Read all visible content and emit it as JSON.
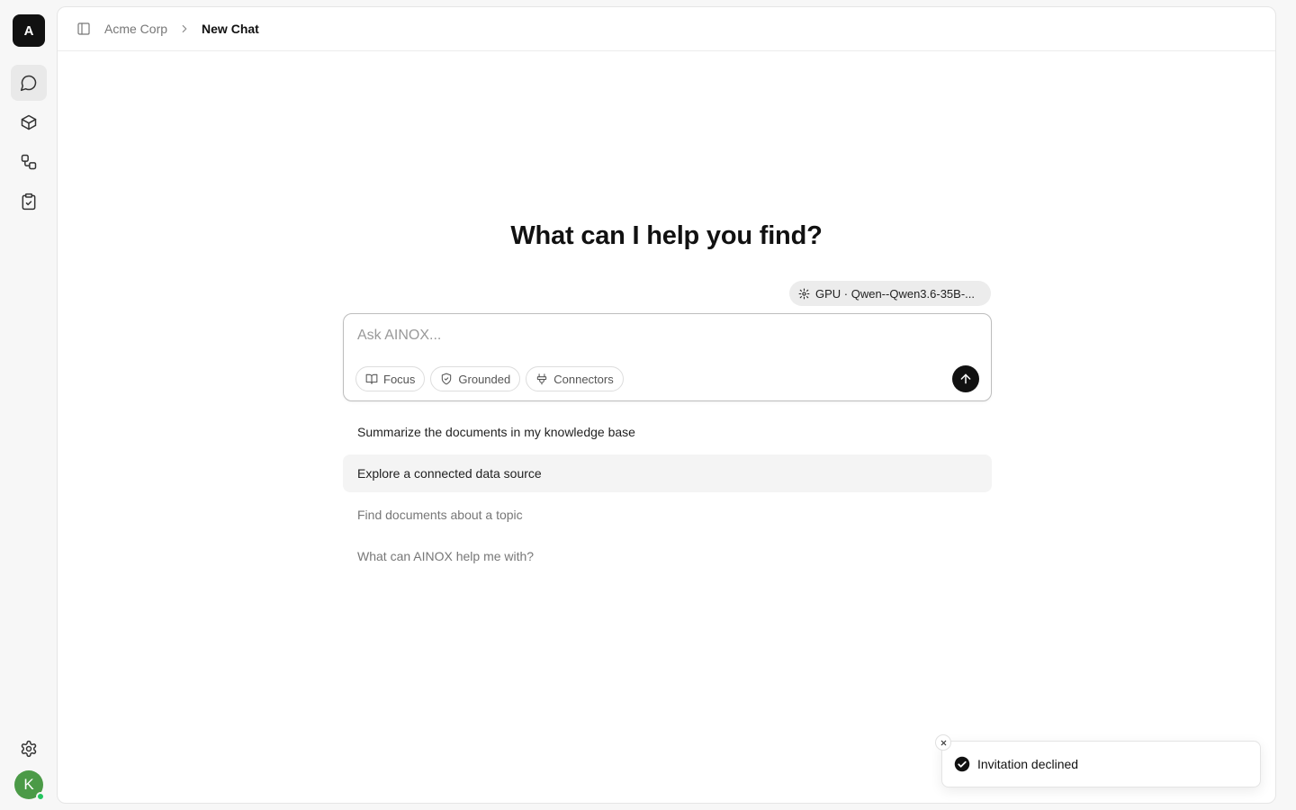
{
  "app": {
    "logo_letter": "A"
  },
  "rail": {
    "items": [
      {
        "name": "chat-icon",
        "active": true
      },
      {
        "name": "box-icon",
        "active": false
      },
      {
        "name": "workflow-icon",
        "active": false
      },
      {
        "name": "clipboard-check-icon",
        "active": false
      }
    ],
    "settings_icon": "gear-icon",
    "avatar_letter": "K"
  },
  "breadcrumb": {
    "org": "Acme Corp",
    "page": "New Chat"
  },
  "main": {
    "heading": "What can I help you find?",
    "model_label": "GPU · Qwen--Qwen3.6-35B-...",
    "composer": {
      "placeholder": "Ask AINOX...",
      "value": "",
      "chips": [
        "Focus",
        "Grounded",
        "Connectors"
      ]
    },
    "suggestions": [
      "Summarize the documents in my knowledge base",
      "Explore a connected data source",
      "Find documents about a topic",
      "What can AINOX help me with?"
    ]
  },
  "toast": {
    "message": "Invitation declined"
  },
  "colors": {
    "accent": "#111111",
    "avatar": "#4b9a47",
    "online": "#22c55e"
  }
}
